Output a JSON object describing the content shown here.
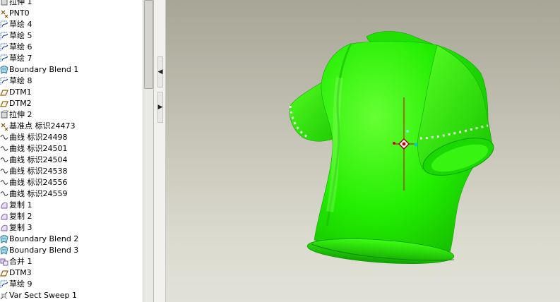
{
  "model_tree": {
    "items": [
      {
        "label": "拉伸 1",
        "icon": "extrude-icon"
      },
      {
        "label": "PNT0",
        "icon": "datum-point-icon"
      },
      {
        "label": "草绘 4",
        "icon": "sketch-icon"
      },
      {
        "label": "草绘 5",
        "icon": "sketch-icon"
      },
      {
        "label": "草绘 6",
        "icon": "sketch-icon"
      },
      {
        "label": "草绘 7",
        "icon": "sketch-icon"
      },
      {
        "label": "Boundary Blend 1",
        "icon": "boundary-blend-icon"
      },
      {
        "label": "草绘 8",
        "icon": "sketch-icon"
      },
      {
        "label": "DTM1",
        "icon": "datum-plane-icon"
      },
      {
        "label": "DTM2",
        "icon": "datum-plane-icon"
      },
      {
        "label": "拉伸 2",
        "icon": "extrude-icon"
      },
      {
        "label": "基准点 标识24473",
        "icon": "datum-point-icon"
      },
      {
        "label": "曲线 标识24498",
        "icon": "curve-icon"
      },
      {
        "label": "曲线 标识24501",
        "icon": "curve-icon"
      },
      {
        "label": "曲线 标识24504",
        "icon": "curve-icon"
      },
      {
        "label": "曲线 标识24538",
        "icon": "curve-icon"
      },
      {
        "label": "曲线 标识24556",
        "icon": "curve-icon"
      },
      {
        "label": "曲线 标识24559",
        "icon": "curve-icon"
      },
      {
        "label": "复制 1",
        "icon": "copy-icon"
      },
      {
        "label": "复制 2",
        "icon": "copy-icon"
      },
      {
        "label": "复制 3",
        "icon": "copy-icon"
      },
      {
        "label": "Boundary Blend 2",
        "icon": "boundary-blend-icon"
      },
      {
        "label": "Boundary Blend 3",
        "icon": "boundary-blend-icon"
      },
      {
        "label": "合并 1",
        "icon": "merge-icon"
      },
      {
        "label": "DTM3",
        "icon": "datum-plane-icon"
      },
      {
        "label": "草绘 9",
        "icon": "sketch-icon"
      },
      {
        "label": "Var Sect Sweep 1",
        "icon": "var-sect-sweep-icon"
      }
    ]
  },
  "splitter": {
    "collapse_glyph": "◀",
    "expand_glyph": "▶"
  },
  "viewport": {
    "model": "t-shirt-solid",
    "colors": {
      "background_top": "#a7a596",
      "background_bottom": "#e2e1d7",
      "model_fill": "#22ee00",
      "model_highlight": "#7dff55",
      "model_shadow": "#11a800",
      "drag_handle": "#cc0000"
    }
  }
}
